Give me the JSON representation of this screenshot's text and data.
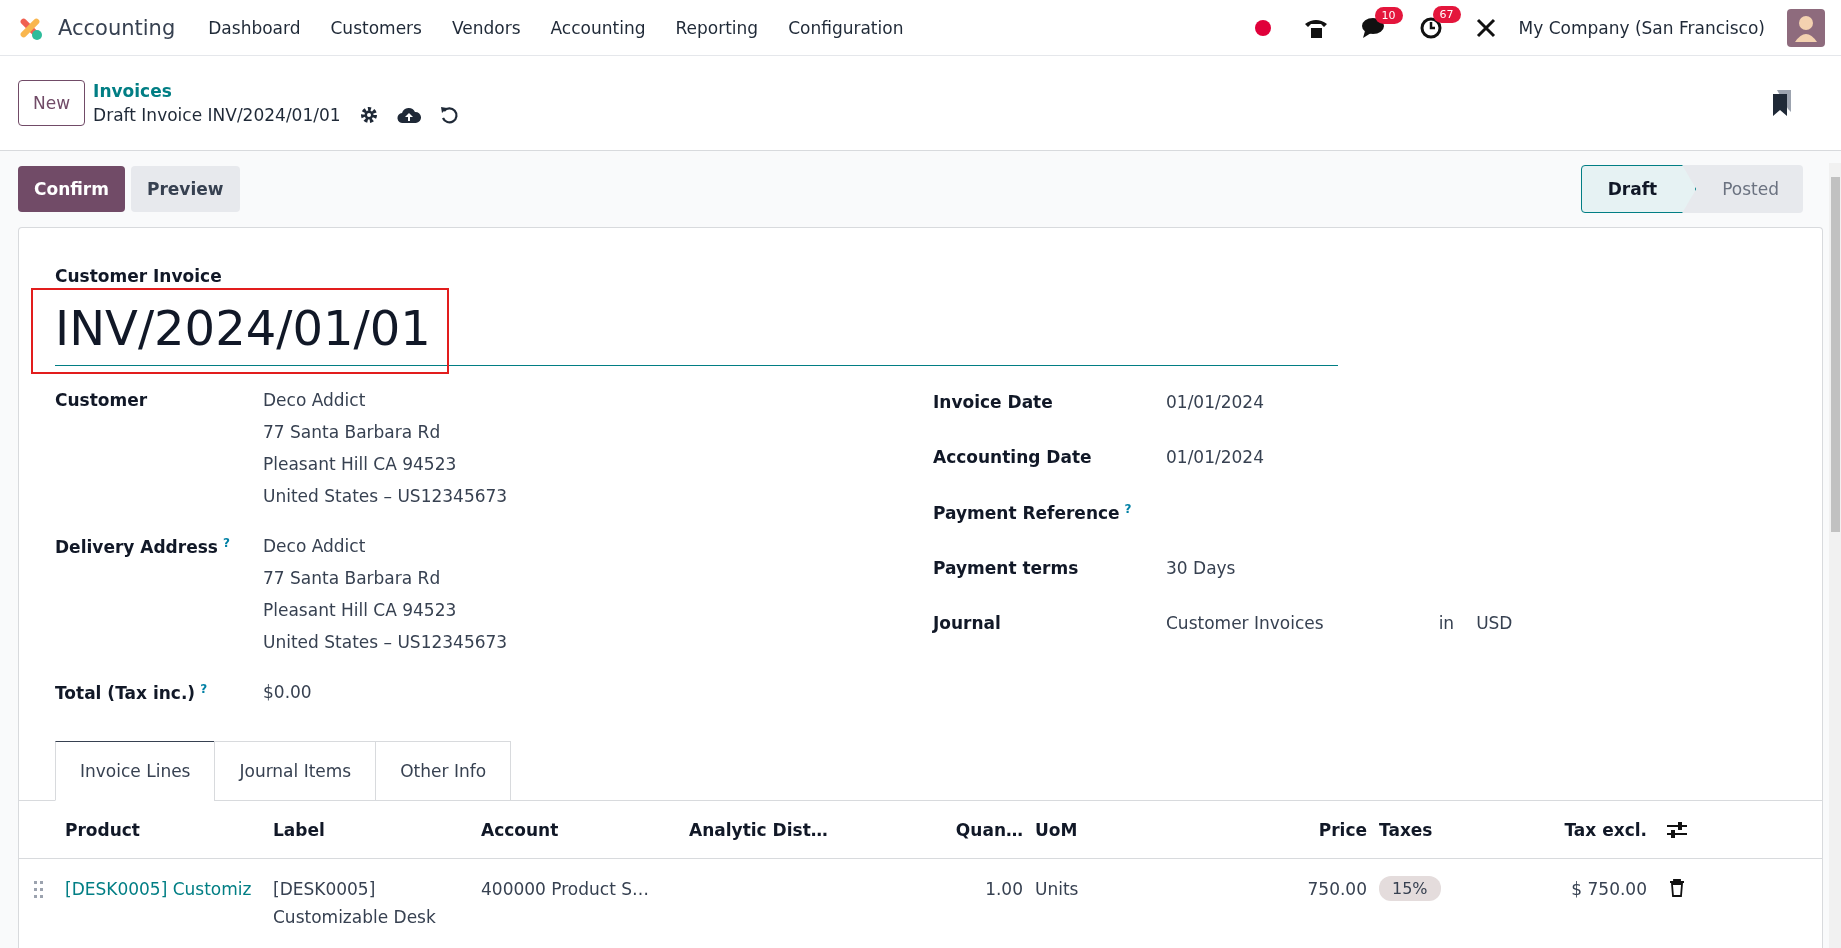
{
  "nav": {
    "app_name": "Accounting",
    "menus": [
      "Dashboard",
      "Customers",
      "Vendors",
      "Accounting",
      "Reporting",
      "Configuration"
    ],
    "messages_count": "10",
    "activities_count": "67",
    "company": "My Company (San Francisco)"
  },
  "breadcrumb": {
    "new_label": "New",
    "parent": "Invoices",
    "current": "Draft Invoice INV/2024/01/01"
  },
  "actions": [
    {
      "label": "Confirm",
      "kind": "primary"
    },
    {
      "label": "Preview",
      "kind": "secondary"
    }
  ],
  "status_steps": [
    {
      "label": "Draft",
      "selected": true
    },
    {
      "label": "Posted",
      "selected": false
    }
  ],
  "form": {
    "title_label": "Customer Invoice",
    "title_value": "INV/2024/01/01",
    "left_fields": [
      {
        "label": "Customer",
        "lines": [
          "Deco Addict",
          "77 Santa Barbara Rd",
          "Pleasant Hill CA 94523",
          "United States – US12345673"
        ]
      },
      {
        "label": "Delivery Address",
        "help": "?",
        "lines": [
          "Deco Addict",
          "77 Santa Barbara Rd",
          "Pleasant Hill CA 94523",
          "United States – US12345673"
        ]
      },
      {
        "label": "Total (Tax inc.)",
        "help": "?",
        "lines": [
          "$0.00"
        ]
      }
    ],
    "right_fields": [
      {
        "label": "Invoice Date",
        "value": "01/01/2024"
      },
      {
        "label": "Accounting Date",
        "value": "01/01/2024"
      },
      {
        "label": "Payment Reference",
        "help": "?"
      },
      {
        "label": "Payment terms",
        "value": "30 Days"
      },
      {
        "label": "Journal",
        "value": "Customer Invoices",
        "connector": "in",
        "currency": "USD"
      }
    ]
  },
  "tabs": [
    {
      "label": "Invoice Lines",
      "selected": true
    },
    {
      "label": "Journal Items",
      "selected": false
    },
    {
      "label": "Other Info",
      "selected": false
    }
  ],
  "table": {
    "columns": [
      {
        "label": "Product",
        "kind": "text"
      },
      {
        "label": "Label",
        "kind": "text"
      },
      {
        "label": "Account",
        "kind": "text"
      },
      {
        "label": "Analytic Dist…",
        "kind": "text"
      },
      {
        "label": "Quan…",
        "kind": "number"
      },
      {
        "label": "UoM",
        "kind": "text"
      },
      {
        "label": "Price",
        "kind": "number"
      },
      {
        "label": "Taxes",
        "kind": "text"
      },
      {
        "label": "Tax excl.",
        "kind": "number"
      }
    ],
    "rows": [
      {
        "product": "[DESK0005] Customiz",
        "label_lines": [
          "[DESK0005]",
          "Customizable Desk"
        ],
        "account": "400000 Product S…",
        "quantity": "1.00",
        "uom": "Units",
        "price": "750.00",
        "taxes": [
          "15%"
        ],
        "subtotal": "$ 750.00"
      }
    ]
  }
}
